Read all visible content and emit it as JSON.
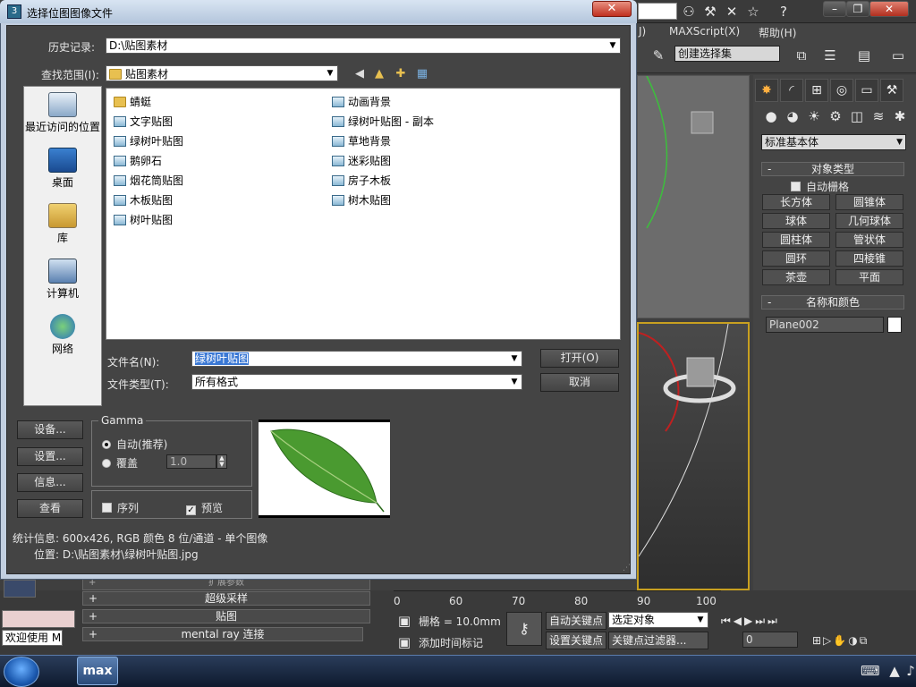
{
  "dialog": {
    "title": "选择位图图像文件",
    "close_label": "✕",
    "history_label": "历史记录:",
    "history_value": "D:\\贴图素材",
    "lookin_label": "查找范围(I):",
    "lookin_value": "贴图素材",
    "places": [
      {
        "label": "最近访问的位置",
        "icon": "recent-places-icon"
      },
      {
        "label": "桌面",
        "icon": "desktop-icon"
      },
      {
        "label": "库",
        "icon": "libraries-icon"
      },
      {
        "label": "计算机",
        "icon": "computer-icon"
      },
      {
        "label": "网络",
        "icon": "network-icon"
      }
    ],
    "files_col1": [
      {
        "name": "蜻蜓",
        "type": "folder"
      },
      {
        "name": "文字贴图",
        "type": "image"
      },
      {
        "name": "绿树叶贴图",
        "type": "image"
      },
      {
        "name": "鹅卵石",
        "type": "image"
      },
      {
        "name": "烟花筒贴图",
        "type": "image"
      },
      {
        "name": "木板贴图",
        "type": "image"
      },
      {
        "name": "树叶贴图",
        "type": "image"
      }
    ],
    "files_col2": [
      {
        "name": "动画背景",
        "type": "image"
      },
      {
        "name": "绿树叶贴图 - 副本",
        "type": "image"
      },
      {
        "name": "草地背景",
        "type": "image"
      },
      {
        "name": "迷彩贴图",
        "type": "image"
      },
      {
        "name": "房子木板",
        "type": "image"
      },
      {
        "name": "树木贴图",
        "type": "image"
      }
    ],
    "filename_label": "文件名(N):",
    "filename_value": "绿树叶贴图",
    "filetype_label": "文件类型(T):",
    "filetype_value": "所有格式",
    "open_button": "打开(O)",
    "cancel_button": "取消",
    "setup_button": "设备...",
    "settings_button": "设置...",
    "info_button": "信息...",
    "view_button": "查看",
    "gamma": {
      "title": "Gamma",
      "auto_label": "自动(推荐)",
      "override_label": "覆盖",
      "override_value": "1.0",
      "selected": "auto"
    },
    "sequence_label": "序列",
    "sequence_checked": false,
    "preview_label": "预览",
    "preview_checked": true,
    "stats_text": "统计信息: 600x426, RGB 颜色 8 位/通道 - 单个图像",
    "location_text": "位置: D:\\贴图素材\\绿树叶贴图.jpg"
  },
  "app": {
    "menu": [
      "J)",
      "MAXScript(X)",
      "帮助(H)"
    ],
    "selection_set": "创建选择集",
    "panel_dropdown": "标准基本体",
    "object_type_title": "对象类型",
    "autogrid_label": "自动栅格",
    "primitives": [
      "长方体",
      "圆锥体",
      "球体",
      "几何球体",
      "圆柱体",
      "管状体",
      "圆环",
      "四棱锥",
      "茶壶",
      "平面"
    ],
    "name_color_title": "名称和颜色",
    "object_name": "Plane002",
    "render_rollouts": [
      "扩展参数",
      "超级采样",
      "贴图",
      "mental ray 连接"
    ],
    "timeline_ticks": [
      "0",
      "60",
      "70",
      "80",
      "90",
      "100"
    ],
    "grid_label": "栅格 = 10.0mm",
    "add_time_tag": "添加时间标记",
    "auto_key": "自动关键点",
    "set_key": "设置关键点",
    "selected_object": "选定对象",
    "key_filters": "关键点过滤器...",
    "frame_value": "0",
    "welcome_text": "欢迎使用 M",
    "taskbar_app": "max"
  }
}
